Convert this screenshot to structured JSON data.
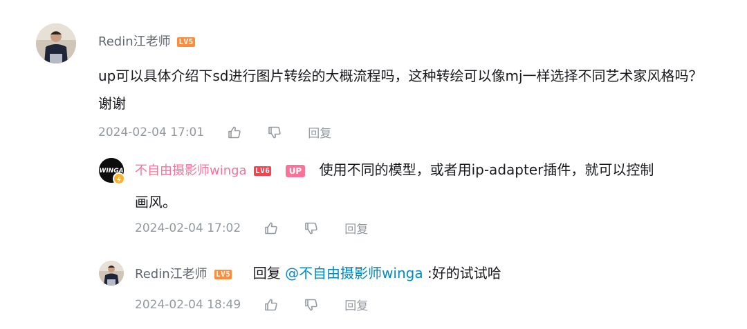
{
  "comment": {
    "user": "Redin江老师",
    "level": "LV5",
    "content": "up可以具体介绍下sd进行图片转绘的大概流程吗，这种转绘可以像mj一样选择不同艺术家风格吗？谢谢",
    "time": "2024-02-04 17:01",
    "reply_label": "回复"
  },
  "replies": [
    {
      "user": "不自由摄影师winga",
      "level": "LV6",
      "up_badge": "UP",
      "content_first": "使用不同的模型，或者用ip-adapter插件，就可以控制",
      "content_second": "画风。",
      "time": "2024-02-04 17:02",
      "reply_label": "回复"
    },
    {
      "user": "Redin江老师",
      "level": "LV5",
      "reply_prefix": "回复",
      "mention": "@不自由摄影师winga",
      "content": ":好的试试哈",
      "time": "2024-02-04 18:49",
      "reply_label": "回复"
    }
  ],
  "colors": {
    "up_name": "#fb7299",
    "lv5": "#ff8c3d",
    "lv6": "#ff3f4b",
    "mention": "#008ac5",
    "meta": "#9499a0"
  },
  "icons": [
    "like-icon",
    "dislike-icon"
  ]
}
